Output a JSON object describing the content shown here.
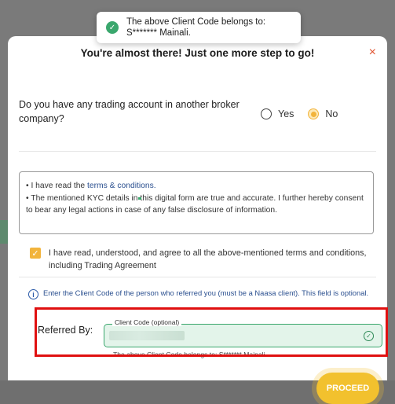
{
  "background": {
    "partial_title": "( .c .)"
  },
  "toast": {
    "icon": "check-circle-icon",
    "line1": "The above Client Code belongs to:",
    "line2": "S******* Mainali."
  },
  "modal": {
    "title": "You're almost there! Just one more step to go!",
    "close": "×",
    "question": "Do you have any trading account in another broker company?",
    "options": {
      "yes": "Yes",
      "no": "No",
      "selected": "No"
    },
    "terms": {
      "bullet1_prefix": "• I have read the ",
      "bullet1_link": "terms & conditions.",
      "bullet2": "• The mentioned KYC details in this digital form are true and accurate. I further hereby consent to bear any legal actions in case of any false disclosure of information."
    },
    "agreement": {
      "checked": true,
      "text": "I have read, understood, and agree to all the above-mentioned terms and conditions, including Trading Agreement"
    },
    "info": "Enter the Client Code of the person who referred you (must be a Naasa client). This field is optional.",
    "referred_by_label": "Referred By:",
    "client_code": {
      "legend": "Client Code (optional)",
      "value": "",
      "valid": true
    },
    "belongs_note": "The above Client Code belongs to: S******* Mainali.",
    "proceed": "PROCEED"
  },
  "colors": {
    "accent": "#f2c12e",
    "close": "#e0532f",
    "success": "#3aa76d",
    "highlight": "#e01010",
    "link": "#2a4f8f"
  }
}
